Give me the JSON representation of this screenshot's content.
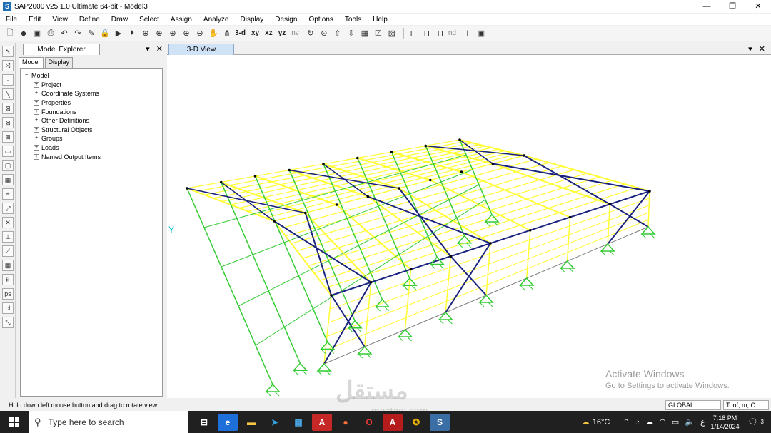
{
  "window": {
    "title": "SAP2000 v25.1.0 Ultimate 64-bit - Model3",
    "controls": [
      "—",
      "❐",
      "✕"
    ]
  },
  "menu": [
    "File",
    "Edit",
    "View",
    "Define",
    "Draw",
    "Select",
    "Assign",
    "Analyze",
    "Display",
    "Design",
    "Options",
    "Tools",
    "Help"
  ],
  "toolbar": {
    "view_labels": [
      "3-d",
      "xy",
      "xz",
      "yz",
      "nv"
    ],
    "nd_label": "nd"
  },
  "explorer": {
    "title": "Model Explorer",
    "tabs": [
      "Model",
      "Display"
    ],
    "root": "Model",
    "items": [
      "Project",
      "Coordinate Systems",
      "Properties",
      "Foundations",
      "Other Definitions",
      "Structural Objects",
      "Groups",
      "Loads",
      "Named Output Items"
    ]
  },
  "viewport": {
    "tab_label": "3-D View",
    "activate_title": "Activate Windows",
    "activate_sub": "Go to Settings to activate Windows.",
    "colors": {
      "roof": "#ffff33",
      "bracing": "#1a237e",
      "frame": "#7a7a7a",
      "support": "#33cc33",
      "joint": "#000000"
    }
  },
  "status": {
    "message": "Hold down left mouse button and drag to rotate view",
    "coord_system": "GLOBAL",
    "units": "Tonf, m, C"
  },
  "taskbar": {
    "search_placeholder": "Type here to search",
    "weather": "16°C",
    "time": "7:18 PM",
    "date": "1/14/2024",
    "notifications": "3",
    "lang": "ع"
  },
  "watermark": {
    "text": "مستقل",
    "sub": "mostaql.com"
  }
}
